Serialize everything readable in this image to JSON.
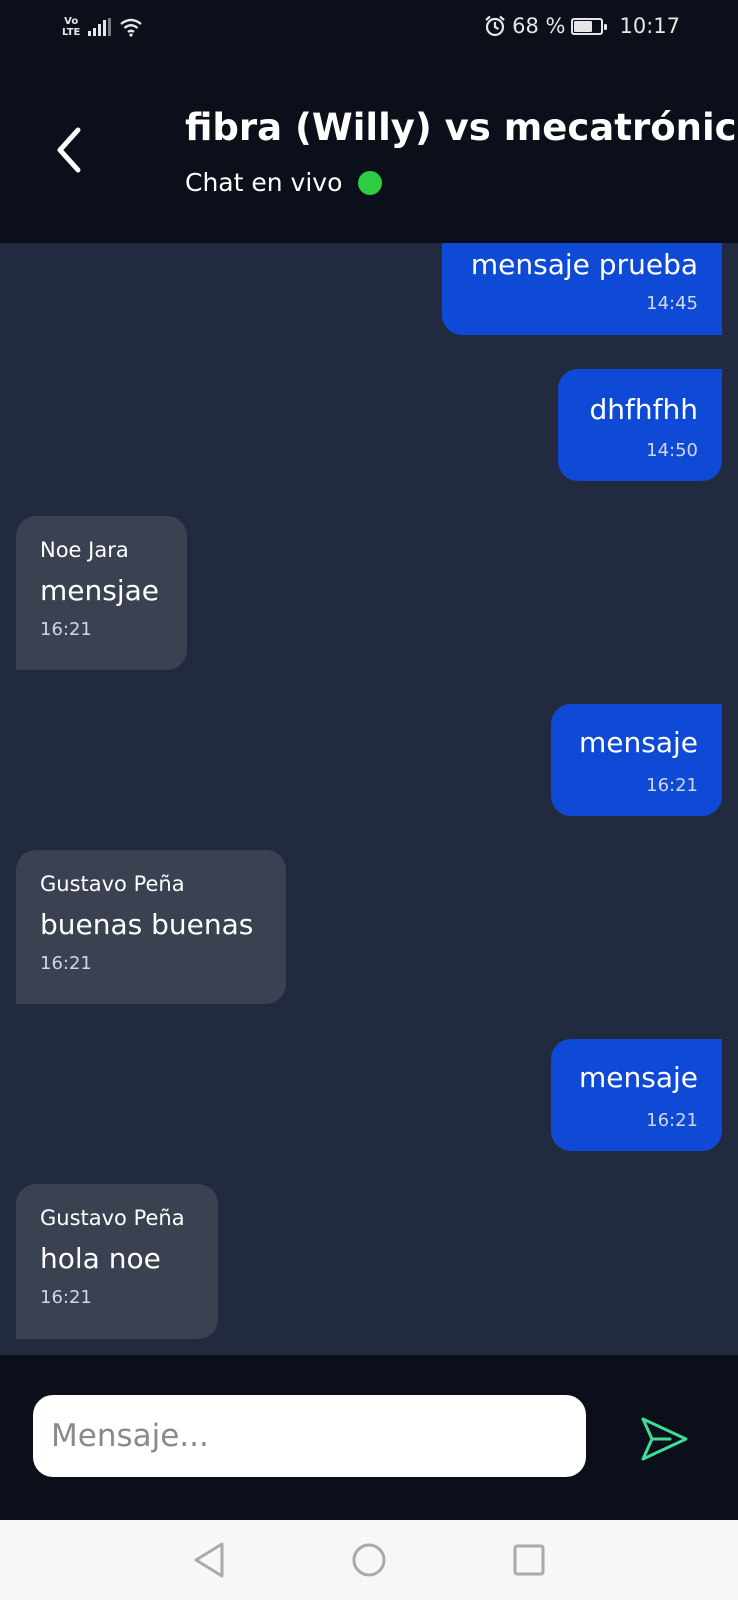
{
  "status_bar": {
    "network": "Vo\nLTE",
    "battery_percent_text": "68 %",
    "battery_level": 0.68,
    "time": "10:17"
  },
  "header": {
    "title": "fibra (Willy) vs mecatrónica",
    "subtitle": "Chat en vivo",
    "online_color": "#2ecc40"
  },
  "messages": [
    {
      "direction": "out",
      "text": "mensaje prueba",
      "time": "14:45"
    },
    {
      "direction": "out",
      "text": "dhfhfhh",
      "time": "14:50"
    },
    {
      "direction": "in",
      "sender": "Noe Jara",
      "text": "mensjae",
      "time": "16:21"
    },
    {
      "direction": "out",
      "text": "mensaje",
      "time": "16:21"
    },
    {
      "direction": "in",
      "sender": "Gustavo Peña",
      "text": "buenas buenas",
      "time": "16:21"
    },
    {
      "direction": "out",
      "text": "mensaje",
      "time": "16:21"
    },
    {
      "direction": "in",
      "sender": "Gustavo Peña",
      "text": "hola noe",
      "time": "16:21"
    }
  ],
  "composer": {
    "placeholder": "Mensaje...",
    "send_icon": "send-icon",
    "send_color": "#3ddc97"
  },
  "colors": {
    "outgoing_bubble": "#0f4ad6",
    "incoming_bubble": "#3a4150",
    "chat_background": "#222a3f",
    "header_background": "#0a0f1a"
  }
}
